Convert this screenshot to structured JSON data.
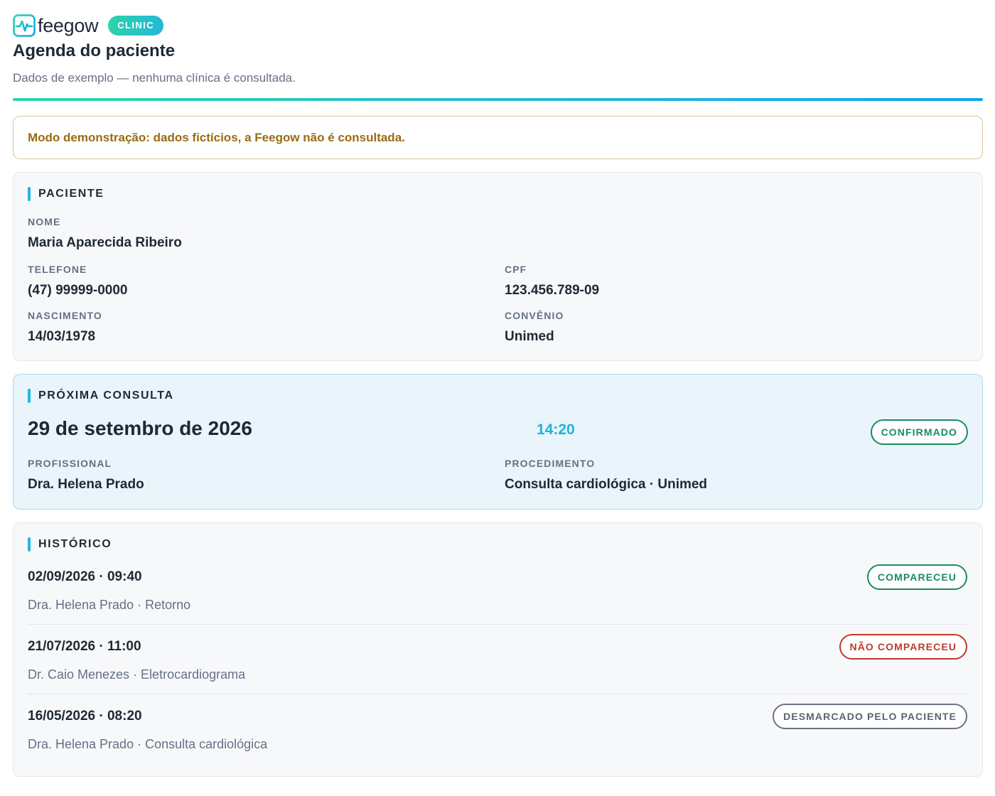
{
  "brand": {
    "logo_text": "feegow",
    "badge": "CLINIC",
    "logo_icon": "pulse-monitor-icon"
  },
  "page": {
    "title": "Agenda do paciente",
    "subtitle": "Dados de exemplo — nenhuma clínica é consultada."
  },
  "alert": {
    "text": "Modo demonstração: dados fictícios, a Feegow não é consultada."
  },
  "patient": {
    "section_title": "PACIENTE",
    "name_label": "NOME",
    "name": "Maria Aparecida Ribeiro",
    "phone_label": "TELEFONE",
    "phone": "(47) 99999-0000",
    "cpf_label": "CPF",
    "cpf": "123.456.789-09",
    "birth_label": "NASCIMENTO",
    "birth": "14/03/1978",
    "insurance_label": "CONVÊNIO",
    "insurance": "Unimed"
  },
  "next_appointment": {
    "section_title": "PRÓXIMA CONSULTA",
    "date": "29 de setembro de 2026",
    "time": "14:20",
    "status": "CONFIRMADO",
    "professional_label": "PROFISSIONAL",
    "professional": "Dra. Helena Prado",
    "procedure_label": "PROCEDIMENTO",
    "procedure": "Consulta cardiológica · Unimed"
  },
  "history": {
    "section_title": "HISTÓRICO",
    "items": [
      {
        "when": "02/09/2026 · 09:40",
        "detail": "Dra. Helena Prado · Retorno",
        "status": "COMPARECEU"
      },
      {
        "when": "21/07/2026 · 11:00",
        "detail": "Dr. Caio Menezes · Eletrocardiograma",
        "status": "NÃO COMPARECEU"
      },
      {
        "when": "16/05/2026 · 08:20",
        "detail": "Dra. Helena Prado · Consulta cardiológica",
        "status": "DESMARCADO PELO PACIENTE"
      }
    ]
  },
  "colors": {
    "accent_cyan": "#22b8d9",
    "accent_green": "#2dd4a7",
    "status_green": "#1a8a64",
    "status_red": "#c0392b",
    "status_gray": "#5b6470",
    "alert_text": "#9a6b12"
  }
}
